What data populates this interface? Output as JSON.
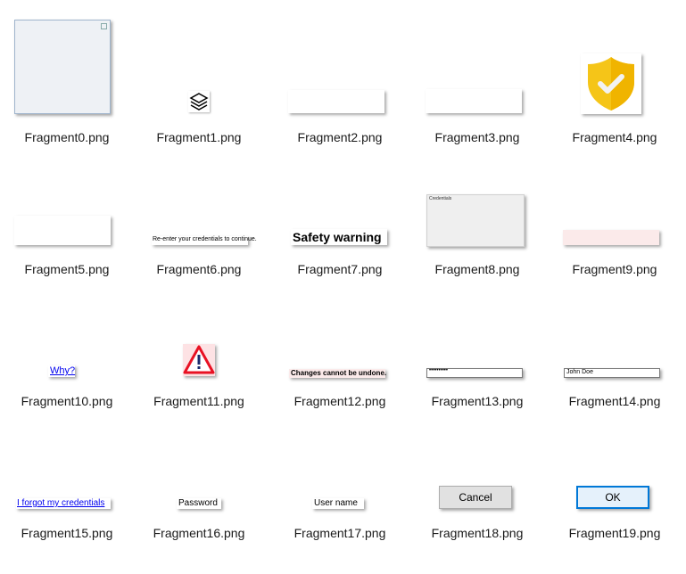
{
  "files": [
    {
      "name": "Fragment0.png"
    },
    {
      "name": "Fragment1.png",
      "icon": "stacked-layers-icon"
    },
    {
      "name": "Fragment2.png"
    },
    {
      "name": "Fragment3.png"
    },
    {
      "name": "Fragment4.png",
      "icon": "shield-check-icon",
      "color": "#f5c518"
    },
    {
      "name": "Fragment5.png"
    },
    {
      "name": "Fragment6.png",
      "text": "Re-enter your credentials to continue."
    },
    {
      "name": "Fragment7.png",
      "text": "Safety warning"
    },
    {
      "name": "Fragment8.png",
      "text": "Credentials"
    },
    {
      "name": "Fragment9.png",
      "color": "#fbeaea"
    },
    {
      "name": "Fragment10.png",
      "text": "Why?"
    },
    {
      "name": "Fragment11.png",
      "icon": "warning-triangle-icon",
      "color": "#e81123"
    },
    {
      "name": "Fragment12.png",
      "text": "Changes cannot be undone."
    },
    {
      "name": "Fragment13.png",
      "value": "••••••••••"
    },
    {
      "name": "Fragment14.png",
      "value": "John Doe"
    },
    {
      "name": "Fragment15.png",
      "text": "I forgot my credentials"
    },
    {
      "name": "Fragment16.png",
      "text": "Password"
    },
    {
      "name": "Fragment17.png",
      "text": "User name"
    },
    {
      "name": "Fragment18.png",
      "text": "Cancel"
    },
    {
      "name": "Fragment19.png",
      "text": "OK",
      "color": "#0078d7"
    }
  ]
}
